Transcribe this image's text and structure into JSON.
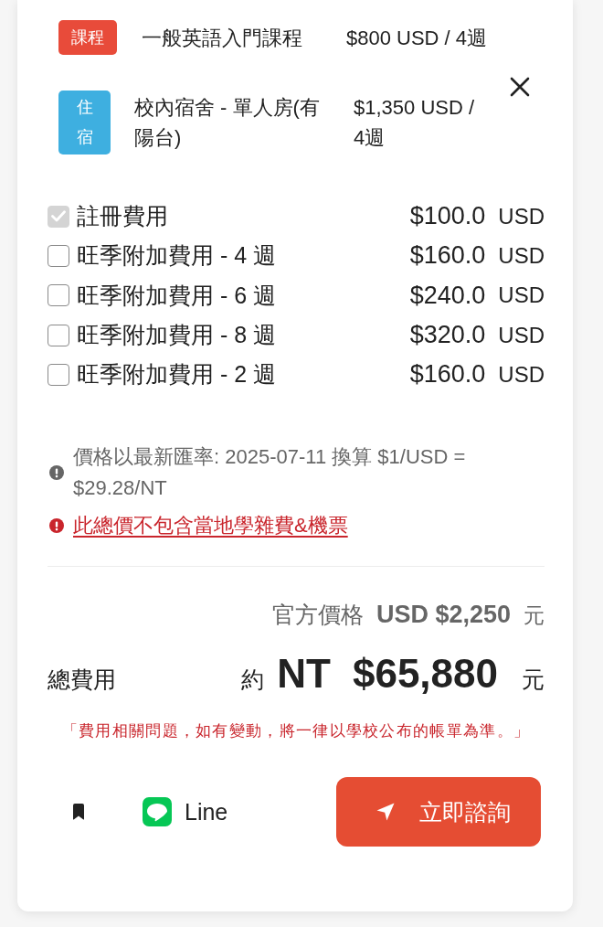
{
  "course_items": [
    {
      "tag": "課程",
      "color": "#e84b3a",
      "name": "一般英語入門課程",
      "price": "$800 USD / 4週",
      "removable": false
    },
    {
      "tag": "住宿",
      "color": "#3eafe0",
      "name": "校內宿舍 - 單人房(有陽台)",
      "price": "$1,350 USD / 4週",
      "removable": true
    }
  ],
  "fees": [
    {
      "label": "註冊費用",
      "amount": "$100.0",
      "currency": "USD",
      "checked": true,
      "disabled": true
    },
    {
      "label": "旺季附加費用 - 4 週",
      "amount": "$160.0",
      "currency": "USD",
      "checked": false,
      "disabled": false
    },
    {
      "label": "旺季附加費用 - 6 週",
      "amount": "$240.0",
      "currency": "USD",
      "checked": false,
      "disabled": false
    },
    {
      "label": "旺季附加費用 - 8 週",
      "amount": "$320.0",
      "currency": "USD",
      "checked": false,
      "disabled": false
    },
    {
      "label": "旺季附加費用 - 2 週",
      "amount": "$160.0",
      "currency": "USD",
      "checked": false,
      "disabled": false
    }
  ],
  "notes": [
    {
      "kind": "info",
      "text": "價格以最新匯率: 2025-07-11 換算 $1/USD = $29.28/NT"
    },
    {
      "kind": "alert",
      "text": "此總價不包含當地學雜費&機票"
    }
  ],
  "official_price": {
    "label": "官方價格",
    "amount": "USD $2,250",
    "unit": "元"
  },
  "total": {
    "label": "總費用",
    "prefix": "約",
    "currency": "NT",
    "amount": "$65,880",
    "unit": "元"
  },
  "disclaimer": "「費用相關問題，如有變動，將一律以學校公布的帳單為準。」",
  "actions": {
    "line_label": "Line",
    "consult_label": "立即諮詢"
  }
}
